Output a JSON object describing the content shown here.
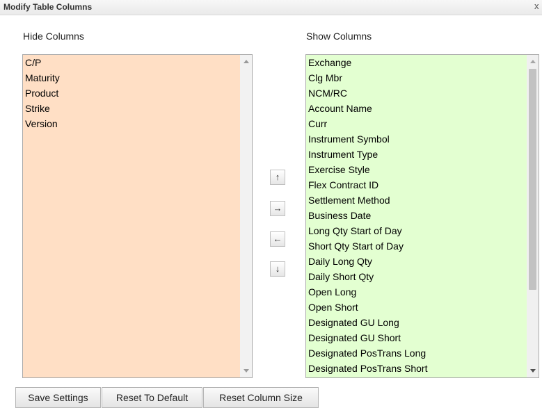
{
  "dialog": {
    "title": "Modify Table Columns",
    "close_glyph": "x"
  },
  "hide_columns": {
    "label": "Hide Columns",
    "items": [
      "C/P",
      "Maturity",
      "Product",
      "Strike",
      "Version"
    ],
    "background_color": "#ffdfc5"
  },
  "show_columns": {
    "label": "Show Columns",
    "items": [
      "Exchange",
      "Clg Mbr",
      "NCM/RC",
      "Account Name",
      "Curr",
      "Instrument Symbol",
      "Instrument Type",
      "Exercise Style",
      "Flex Contract ID",
      "Settlement Method",
      "Business Date",
      "Long Qty Start of Day",
      "Short Qty Start of Day",
      "Daily Long Qty",
      "Daily Short Qty",
      "Open Long",
      "Open Short",
      "Designated GU Long",
      "Designated GU Short",
      "Designated PosTrans Long",
      "Designated PosTrans Short"
    ],
    "background_color": "#e3ffd1"
  },
  "move_buttons": {
    "up": "↑",
    "right": "→",
    "left": "←",
    "down": "↓"
  },
  "buttons": {
    "save": "Save Settings",
    "reset_default": "Reset To Default",
    "reset_size": "Reset Column Size"
  }
}
